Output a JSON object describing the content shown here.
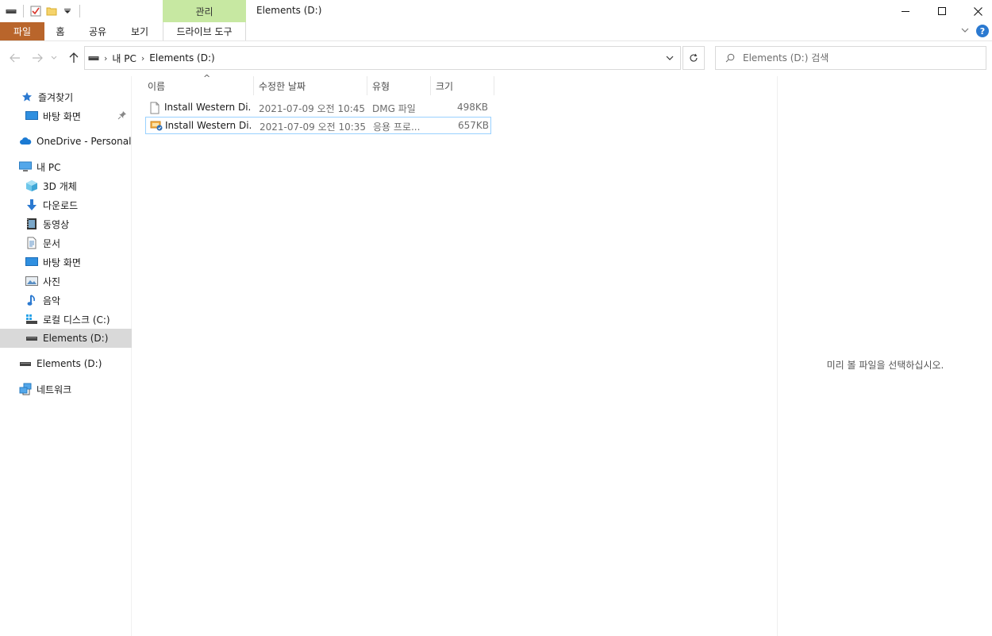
{
  "window": {
    "title": "Elements (D:)",
    "context_tab_title": "관리"
  },
  "ribbon": {
    "tabs": [
      "파일",
      "홈",
      "공유",
      "보기"
    ],
    "context_tab": "드라이브 도구"
  },
  "address": {
    "crumbs": [
      "내 PC",
      "Elements (D:)"
    ]
  },
  "search": {
    "placeholder": "Elements (D:) 검색"
  },
  "sidebar": {
    "items": [
      {
        "label": "즐겨찾기",
        "icon": "star-icon"
      },
      {
        "label": "바탕 화면",
        "icon": "desktop-icon"
      },
      {
        "label": "OneDrive - Personal",
        "icon": "cloud-icon"
      },
      {
        "label": "내 PC",
        "icon": "computer-icon"
      },
      {
        "label": "3D 개체",
        "icon": "cube-icon"
      },
      {
        "label": "다운로드",
        "icon": "download-icon"
      },
      {
        "label": "동영상",
        "icon": "video-icon"
      },
      {
        "label": "문서",
        "icon": "document-icon"
      },
      {
        "label": "바탕 화면",
        "icon": "desktop-icon"
      },
      {
        "label": "사진",
        "icon": "picture-icon"
      },
      {
        "label": "음악",
        "icon": "music-icon"
      },
      {
        "label": "로컬 디스크 (C:)",
        "icon": "drive-icon"
      },
      {
        "label": "Elements (D:)",
        "icon": "drive-icon"
      },
      {
        "label": "Elements (D:)",
        "icon": "drive-icon"
      },
      {
        "label": "네트워크",
        "icon": "network-icon"
      }
    ]
  },
  "filelist": {
    "columns": [
      "이름",
      "수정한 날짜",
      "유형",
      "크기"
    ],
    "rows": [
      {
        "name": "Install Western Di...",
        "date": "2021-07-09 오전 10:45",
        "type": "DMG 파일",
        "size": "498KB"
      },
      {
        "name": "Install Western Di...",
        "date": "2021-07-09 오전 10:35",
        "type": "응용 프로...",
        "size": "657KB"
      }
    ]
  },
  "preview": {
    "message": "미리 볼 파일을 선택하십시오."
  },
  "colors": {
    "file_tab": "#b9652b",
    "context_tab": "#c7e8a2",
    "selection_border": "#99d1ff",
    "nav_selected": "#d9d9d9"
  }
}
